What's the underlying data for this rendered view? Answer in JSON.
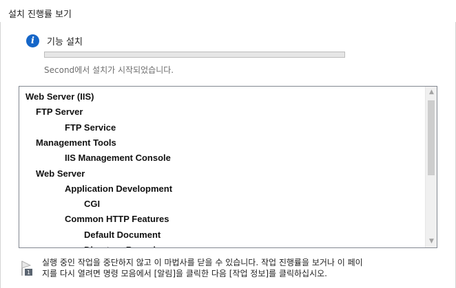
{
  "page": {
    "heading": "설치 진행률 보기"
  },
  "task": {
    "label": "기능 설치",
    "status_text": "Second에서 설치가 시작되었습니다.",
    "progress_fraction": 0.0,
    "icon": "info-icon",
    "accent_color": "#1566c8"
  },
  "tree": {
    "items": [
      {
        "label": "Web Server (IIS)",
        "level": 0
      },
      {
        "label": "FTP Server",
        "level": 1
      },
      {
        "label": "FTP Service",
        "level": 2
      },
      {
        "label": "Management Tools",
        "level": 1
      },
      {
        "label": "IIS Management Console",
        "level": 2
      },
      {
        "label": "Web Server",
        "level": 1
      },
      {
        "label": "Application Development",
        "level": 2
      },
      {
        "label": "CGI",
        "level": 3
      },
      {
        "label": "Common HTTP Features",
        "level": 2
      },
      {
        "label": "Default Document",
        "level": 3
      },
      {
        "label": "Directory Browsing",
        "level": 3
      }
    ]
  },
  "note": {
    "icon": "flag-icon",
    "line1": "실행 중인 작업을 중단하지 않고 이 마법사를 닫을 수 있습니다. 작업 진행률을 보거나 이 페이",
    "line2": "지를 다시 열려면 명령 모음에서 [알림]을 클릭한 다음 [작업 정보]를 클릭하십시오."
  }
}
